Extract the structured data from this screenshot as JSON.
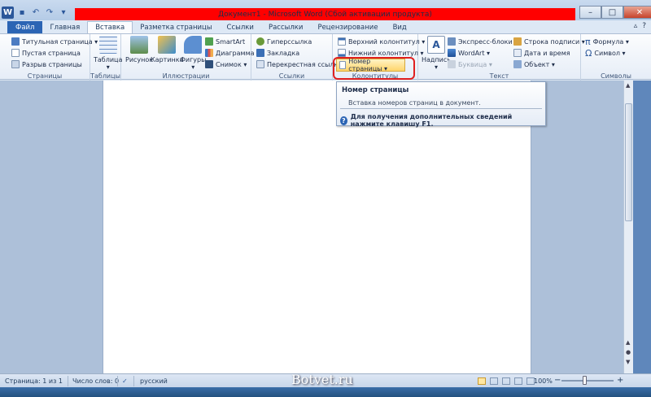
{
  "titlebar": {
    "title": "Документ1 - Microsoft Word (Сбой активации продукта)"
  },
  "window_controls": {
    "minimize": "–",
    "maximize": "□",
    "close": "✕"
  },
  "tabs": [
    {
      "label": "Файл"
    },
    {
      "label": "Главная"
    },
    {
      "label": "Вставка"
    },
    {
      "label": "Разметка страницы"
    },
    {
      "label": "Ссылки"
    },
    {
      "label": "Рассылки"
    },
    {
      "label": "Рецензирование"
    },
    {
      "label": "Вид"
    }
  ],
  "ribbon_controls": {
    "collapse": "▵",
    "help": "?"
  },
  "groups": {
    "pages": {
      "label": "Страницы",
      "items": [
        "Титульная страница ▾",
        "Пустая страница",
        "Разрыв страницы"
      ]
    },
    "tables": {
      "label": "Таблицы",
      "items": [
        "Таблица"
      ]
    },
    "illustrations": {
      "label": "Иллюстрации",
      "items": [
        "Рисунок",
        "Картинка",
        "Фигуры",
        "SmartArt",
        "Диаграмма",
        "Снимок ▾"
      ]
    },
    "links": {
      "label": "Ссылки",
      "items": [
        "Гиперссылка",
        "Закладка",
        "Перекрестная ссылка"
      ]
    },
    "header_footer": {
      "label": "Колонтитулы",
      "items": [
        "Верхний колонтитул ▾",
        "Нижний колонтитул ▾",
        "Номер страницы ▾"
      ]
    },
    "text": {
      "label": "Текст",
      "items": [
        "Надпись",
        "Экспресс-блоки ▾",
        "WordArt ▾",
        "Буквица ▾",
        "Строка подписи ▾",
        "Дата и время",
        "Объект ▾"
      ]
    },
    "symbols": {
      "label": "Символы",
      "items": [
        "Формула ▾",
        "Символ ▾"
      ]
    }
  },
  "tooltip": {
    "title": "Номер страницы",
    "description": "Вставка номеров страниц в документ.",
    "help": "Для получения дополнительных сведений нажмите клавишу F1."
  },
  "statusbar": {
    "page": "Страница: 1 из 1",
    "words": "Число слов: 0",
    "language": "русский",
    "zoom": "100%",
    "zoom_minus": "−",
    "zoom_plus": "+"
  },
  "watermark": "Botvet.ru",
  "colors": {
    "accent": "#2b579a",
    "file_tab": "#2b64b4",
    "highlight_ring": "#e02020",
    "title_overlay": "#ff0000"
  }
}
